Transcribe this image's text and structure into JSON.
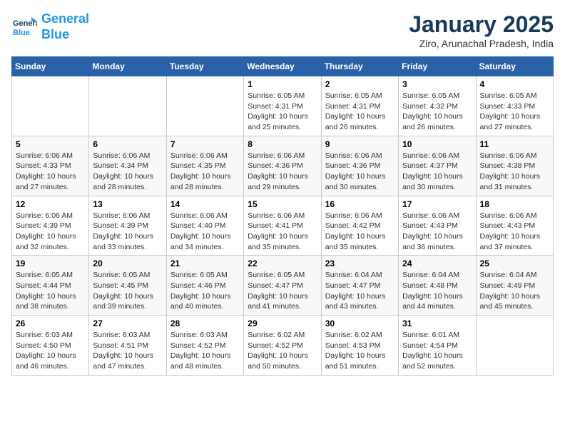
{
  "header": {
    "logo_line1": "General",
    "logo_line2": "Blue",
    "month_title": "January 2025",
    "subtitle": "Ziro, Arunachal Pradesh, India"
  },
  "days_of_week": [
    "Sunday",
    "Monday",
    "Tuesday",
    "Wednesday",
    "Thursday",
    "Friday",
    "Saturday"
  ],
  "weeks": [
    [
      {
        "day": "",
        "info": ""
      },
      {
        "day": "",
        "info": ""
      },
      {
        "day": "",
        "info": ""
      },
      {
        "day": "1",
        "info": "Sunrise: 6:05 AM\nSunset: 4:31 PM\nDaylight: 10 hours\nand 25 minutes."
      },
      {
        "day": "2",
        "info": "Sunrise: 6:05 AM\nSunset: 4:31 PM\nDaylight: 10 hours\nand 26 minutes."
      },
      {
        "day": "3",
        "info": "Sunrise: 6:05 AM\nSunset: 4:32 PM\nDaylight: 10 hours\nand 26 minutes."
      },
      {
        "day": "4",
        "info": "Sunrise: 6:05 AM\nSunset: 4:33 PM\nDaylight: 10 hours\nand 27 minutes."
      }
    ],
    [
      {
        "day": "5",
        "info": "Sunrise: 6:06 AM\nSunset: 4:33 PM\nDaylight: 10 hours\nand 27 minutes."
      },
      {
        "day": "6",
        "info": "Sunrise: 6:06 AM\nSunset: 4:34 PM\nDaylight: 10 hours\nand 28 minutes."
      },
      {
        "day": "7",
        "info": "Sunrise: 6:06 AM\nSunset: 4:35 PM\nDaylight: 10 hours\nand 28 minutes."
      },
      {
        "day": "8",
        "info": "Sunrise: 6:06 AM\nSunset: 4:36 PM\nDaylight: 10 hours\nand 29 minutes."
      },
      {
        "day": "9",
        "info": "Sunrise: 6:06 AM\nSunset: 4:36 PM\nDaylight: 10 hours\nand 30 minutes."
      },
      {
        "day": "10",
        "info": "Sunrise: 6:06 AM\nSunset: 4:37 PM\nDaylight: 10 hours\nand 30 minutes."
      },
      {
        "day": "11",
        "info": "Sunrise: 6:06 AM\nSunset: 4:38 PM\nDaylight: 10 hours\nand 31 minutes."
      }
    ],
    [
      {
        "day": "12",
        "info": "Sunrise: 6:06 AM\nSunset: 4:39 PM\nDaylight: 10 hours\nand 32 minutes."
      },
      {
        "day": "13",
        "info": "Sunrise: 6:06 AM\nSunset: 4:39 PM\nDaylight: 10 hours\nand 33 minutes."
      },
      {
        "day": "14",
        "info": "Sunrise: 6:06 AM\nSunset: 4:40 PM\nDaylight: 10 hours\nand 34 minutes."
      },
      {
        "day": "15",
        "info": "Sunrise: 6:06 AM\nSunset: 4:41 PM\nDaylight: 10 hours\nand 35 minutes."
      },
      {
        "day": "16",
        "info": "Sunrise: 6:06 AM\nSunset: 4:42 PM\nDaylight: 10 hours\nand 35 minutes."
      },
      {
        "day": "17",
        "info": "Sunrise: 6:06 AM\nSunset: 4:43 PM\nDaylight: 10 hours\nand 36 minutes."
      },
      {
        "day": "18",
        "info": "Sunrise: 6:06 AM\nSunset: 4:43 PM\nDaylight: 10 hours\nand 37 minutes."
      }
    ],
    [
      {
        "day": "19",
        "info": "Sunrise: 6:05 AM\nSunset: 4:44 PM\nDaylight: 10 hours\nand 38 minutes."
      },
      {
        "day": "20",
        "info": "Sunrise: 6:05 AM\nSunset: 4:45 PM\nDaylight: 10 hours\nand 39 minutes."
      },
      {
        "day": "21",
        "info": "Sunrise: 6:05 AM\nSunset: 4:46 PM\nDaylight: 10 hours\nand 40 minutes."
      },
      {
        "day": "22",
        "info": "Sunrise: 6:05 AM\nSunset: 4:47 PM\nDaylight: 10 hours\nand 41 minutes."
      },
      {
        "day": "23",
        "info": "Sunrise: 6:04 AM\nSunset: 4:47 PM\nDaylight: 10 hours\nand 43 minutes."
      },
      {
        "day": "24",
        "info": "Sunrise: 6:04 AM\nSunset: 4:48 PM\nDaylight: 10 hours\nand 44 minutes."
      },
      {
        "day": "25",
        "info": "Sunrise: 6:04 AM\nSunset: 4:49 PM\nDaylight: 10 hours\nand 45 minutes."
      }
    ],
    [
      {
        "day": "26",
        "info": "Sunrise: 6:03 AM\nSunset: 4:50 PM\nDaylight: 10 hours\nand 46 minutes."
      },
      {
        "day": "27",
        "info": "Sunrise: 6:03 AM\nSunset: 4:51 PM\nDaylight: 10 hours\nand 47 minutes."
      },
      {
        "day": "28",
        "info": "Sunrise: 6:03 AM\nSunset: 4:52 PM\nDaylight: 10 hours\nand 48 minutes."
      },
      {
        "day": "29",
        "info": "Sunrise: 6:02 AM\nSunset: 4:52 PM\nDaylight: 10 hours\nand 50 minutes."
      },
      {
        "day": "30",
        "info": "Sunrise: 6:02 AM\nSunset: 4:53 PM\nDaylight: 10 hours\nand 51 minutes."
      },
      {
        "day": "31",
        "info": "Sunrise: 6:01 AM\nSunset: 4:54 PM\nDaylight: 10 hours\nand 52 minutes."
      },
      {
        "day": "",
        "info": ""
      }
    ]
  ]
}
